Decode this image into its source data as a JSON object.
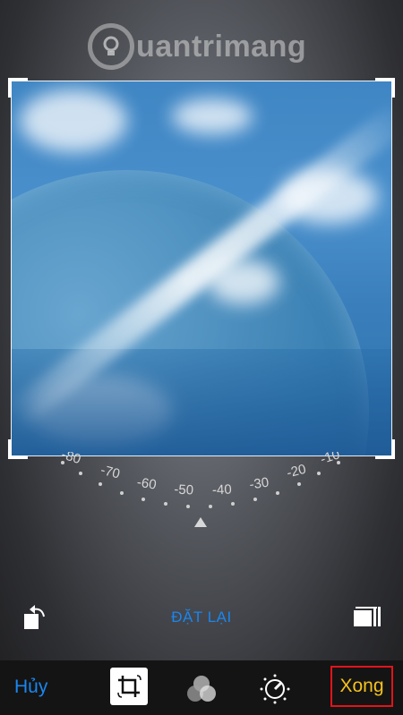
{
  "watermark": {
    "text": "uantrimang",
    "logo_letter": "Q"
  },
  "dial": {
    "labels": [
      "-80",
      "-70",
      "-60",
      "-50",
      "-40",
      "-30",
      "-20",
      "-10"
    ]
  },
  "toolbar": {
    "rotate_icon": "rotate-left-icon",
    "reset_label": "ĐẶT LẠI",
    "aspect_icon": "aspect-ratio-icon"
  },
  "bottom_bar": {
    "cancel_label": "Hủy",
    "done_label": "Xong",
    "tools": [
      "crop-rotate-icon",
      "filters-icon",
      "adjust-dial-icon"
    ]
  },
  "colors": {
    "accent": "#1a86f0",
    "done_text": "#f6c21d",
    "highlight_box": "#e3131b"
  }
}
